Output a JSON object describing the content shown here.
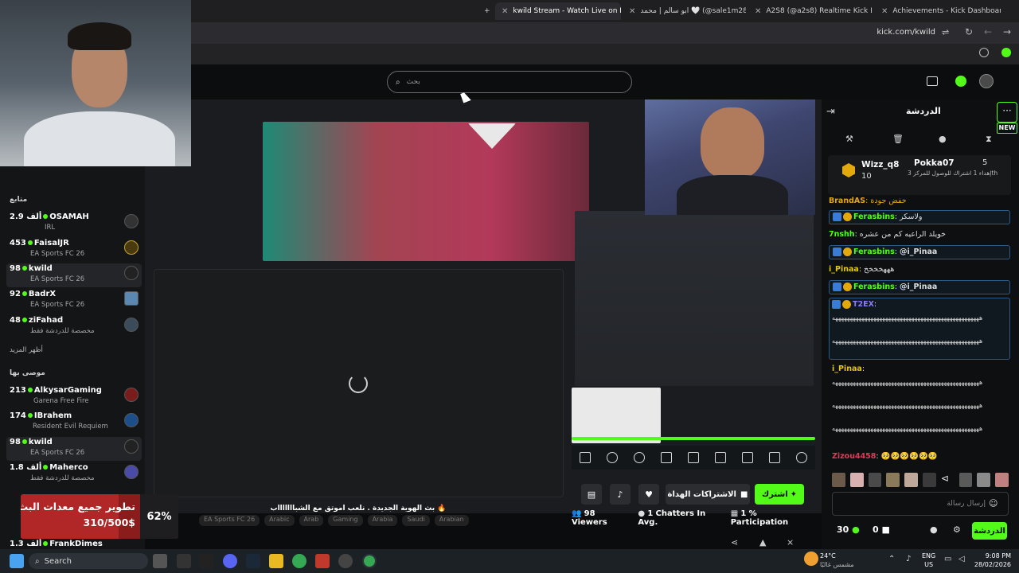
{
  "browser": {
    "tabs": [
      {
        "label": "kwild Stream - Watch Live on K",
        "active": true
      },
      {
        "label": "ابو سالم | محمد 🤍 (@sale1m28",
        "active": false
      },
      {
        "label": "A2S8 (@a2s8) Realtime Kick Liv",
        "active": false
      },
      {
        "label": "Achievements - Kick Dashboard",
        "active": false
      }
    ],
    "address": "kick.com/kwild"
  },
  "header": {
    "search_placeholder": "بحث"
  },
  "sidebar": {
    "following_title": "متابع",
    "following": [
      {
        "viewers": "2.9 ألف",
        "name": "OSAMAH",
        "category": "IRL"
      },
      {
        "viewers": "453",
        "name": "FaisalJR",
        "category": "EA Sports FC 26"
      },
      {
        "viewers": "98",
        "name": "kwild",
        "category": "EA Sports FC 26"
      },
      {
        "viewers": "92",
        "name": "BadrX",
        "category": "EA Sports FC 26"
      },
      {
        "viewers": "48",
        "name": "ziFahad",
        "category": "مخصصة للدردشة فقط"
      }
    ],
    "show_more": "أظهر المزيد",
    "recommended_title": "موصى بها",
    "recommended": [
      {
        "viewers": "213",
        "name": "AlkysarGaming",
        "category": "Garena Free Fire"
      },
      {
        "viewers": "174",
        "name": "IBrahem",
        "category": "Resident Evil Requiem"
      },
      {
        "viewers": "98",
        "name": "kwild",
        "category": "EA Sports FC 26"
      },
      {
        "viewers": "1.8 ألف",
        "name": "Maherco",
        "category": "مخصصة للدردشة فقط"
      },
      {
        "viewers": "1.3 ألف",
        "name": "FrankDimes",
        "category": ""
      }
    ]
  },
  "stream": {
    "title": "بث الهوية الجديدة . نلعب اموتق مع الشباااااااب 🔥",
    "tags": [
      "EA Sports FC 26",
      "Arabic",
      "Arab",
      "Gaming",
      "Arabia",
      "Saudi",
      "Arabian"
    ]
  },
  "actions": {
    "subscribe": "اشترك",
    "gift_subs": "الاشتراكات الهداة"
  },
  "stats": {
    "viewers": "98",
    "viewers_label": "Viewers",
    "chatters": "1",
    "chatters_label": "Chatters In Avg.",
    "participation": "1",
    "participation_label": "% Participation"
  },
  "goal": {
    "title": "تطوير جميع معدات البث",
    "amount": "310/500$",
    "percent_text": "62%",
    "progress": 0.62
  },
  "chat": {
    "title": "الدردشة",
    "new_badge": "NEW",
    "pinned": [
      {
        "name": "Wizz_q8",
        "points": "10"
      },
      {
        "name": "Pokka07",
        "points": "5",
        "sub": "إهداء 1 اشتراك للوصول للمركز 3th"
      }
    ],
    "messages": [
      {
        "user": "BrandAS",
        "text": "خفض جودة"
      },
      {
        "user": "Ferasbins",
        "text": "ولاسكر",
        "hl": true
      },
      {
        "user": "7nshh",
        "text": "خويلد الراعيه كم من عشره"
      },
      {
        "user": "Ferasbins",
        "text": "@i_Pinaa",
        "hl": true
      },
      {
        "user": "i_Pinaa",
        "text": "هههخخخخ"
      },
      {
        "user": "Ferasbins",
        "text": "@i_Pinaa",
        "hl": true
      },
      {
        "user": "T2EX",
        "text": "",
        "hl": true
      },
      {
        "user": "i_Pinaa",
        "text": ""
      },
      {
        "user": "Zizou4458",
        "text": "🥺🥺🥺🥺🥺🥺"
      }
    ],
    "long_line": "ههههههههههههههههههههههههههههههههههههههههههههههههههه",
    "input_placeholder": "إرسال رسالة",
    "points": "30",
    "zero": "0",
    "send_label": "الدردشة"
  },
  "taskbar": {
    "search_label": "Search",
    "weather_temp": "24°C",
    "weather_desc": "مشمس غالبًا",
    "lang": "ENG",
    "region": "US",
    "time": "9:08 PM",
    "date": "28/02/2026"
  }
}
